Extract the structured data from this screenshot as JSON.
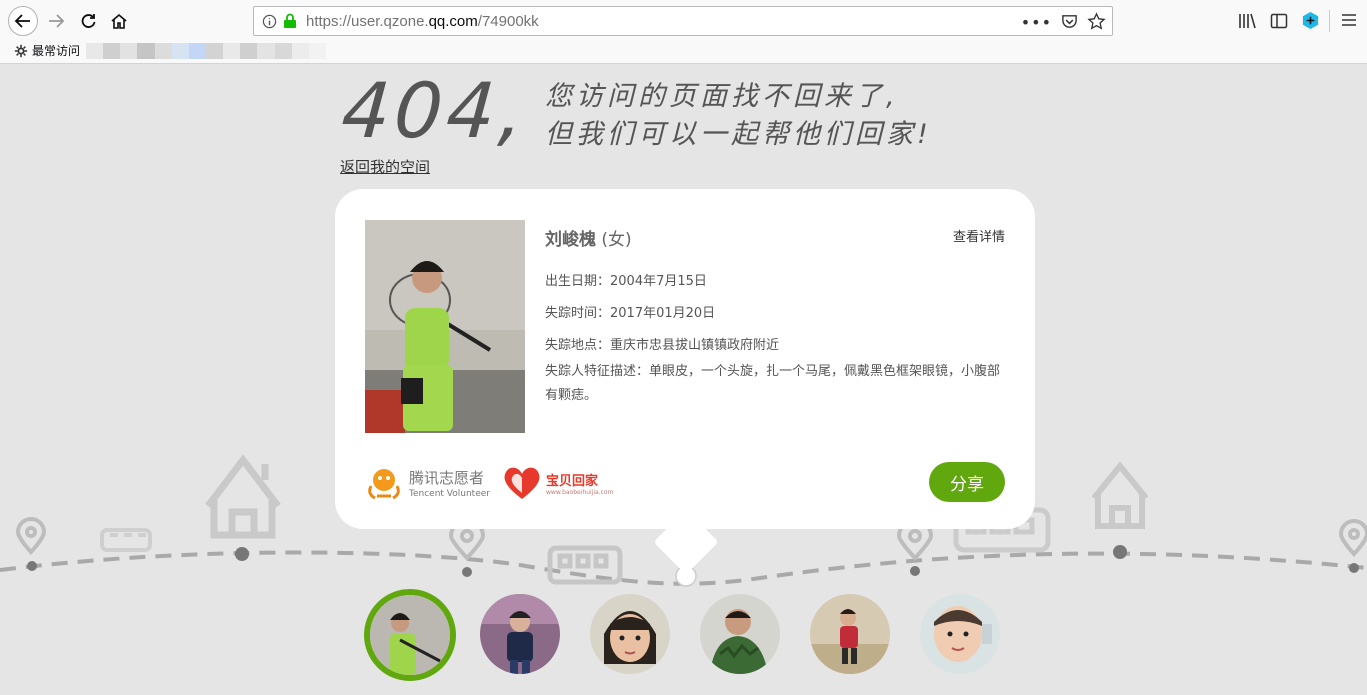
{
  "browser": {
    "url_prefix": "https://user.qzone.",
    "url_domain": "qq.com",
    "url_suffix": "/74900kk",
    "bookmark_label": "最常访问"
  },
  "page": {
    "code": "404,",
    "message_line1": "您访问的页面找不回来了,",
    "message_line2": "但我们可以一起帮他们回家!",
    "back_link": "返回我的空间"
  },
  "card": {
    "name": "刘峻槐",
    "gender": "(女)",
    "detail_link": "查看详情",
    "birth": "出生日期：2004年7月15日",
    "missing_time": "失踪时间：2017年01月20日",
    "missing_place": "失踪地点：重庆市忠县拔山镇镇政府附近",
    "description": "失踪人特征描述：单眼皮，一个头旋，扎一个马尾，佩戴黑色框架眼镜，小腹部有颗痣。",
    "share_label": "分享",
    "org1_cn": "腾讯志愿者",
    "org1_en": "Tencent Volunteer",
    "org2_cn": "宝贝回家",
    "org2_en": "www.baobeihuijia.com"
  },
  "colors": {
    "accent": "#61a80e",
    "background": "#e5e5e5"
  },
  "avatars": [
    "child-1",
    "child-2",
    "child-3",
    "child-4",
    "child-5",
    "child-6"
  ]
}
